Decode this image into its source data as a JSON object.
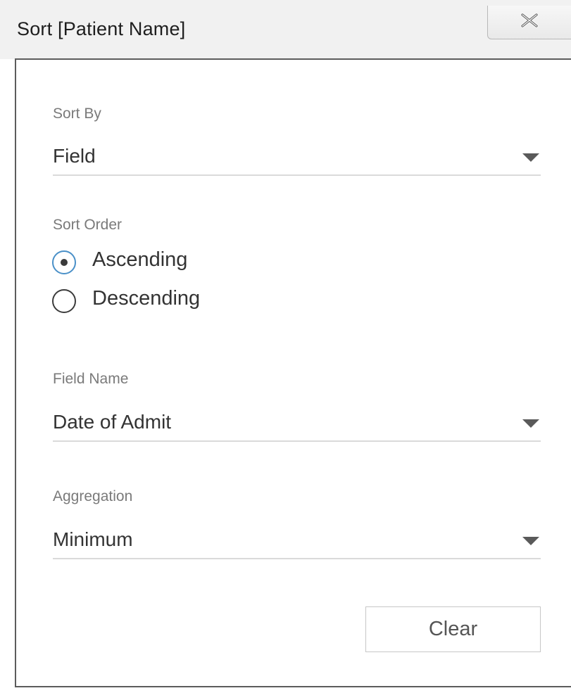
{
  "dialog": {
    "title": "Sort [Patient Name]",
    "close_icon": "close-icon"
  },
  "sort_by": {
    "label": "Sort By",
    "value": "Field"
  },
  "sort_order": {
    "label": "Sort Order",
    "options": [
      {
        "label": "Ascending",
        "selected": true
      },
      {
        "label": "Descending",
        "selected": false
      }
    ]
  },
  "field_name": {
    "label": "Field Name",
    "value": "Date of Admit"
  },
  "aggregation": {
    "label": "Aggregation",
    "value": "Minimum"
  },
  "actions": {
    "clear_label": "Clear"
  },
  "colors": {
    "radio_selected_ring": "#4a90c8",
    "panel_border": "#5c5c5c",
    "titlebar_bg": "#f1f1f1"
  }
}
